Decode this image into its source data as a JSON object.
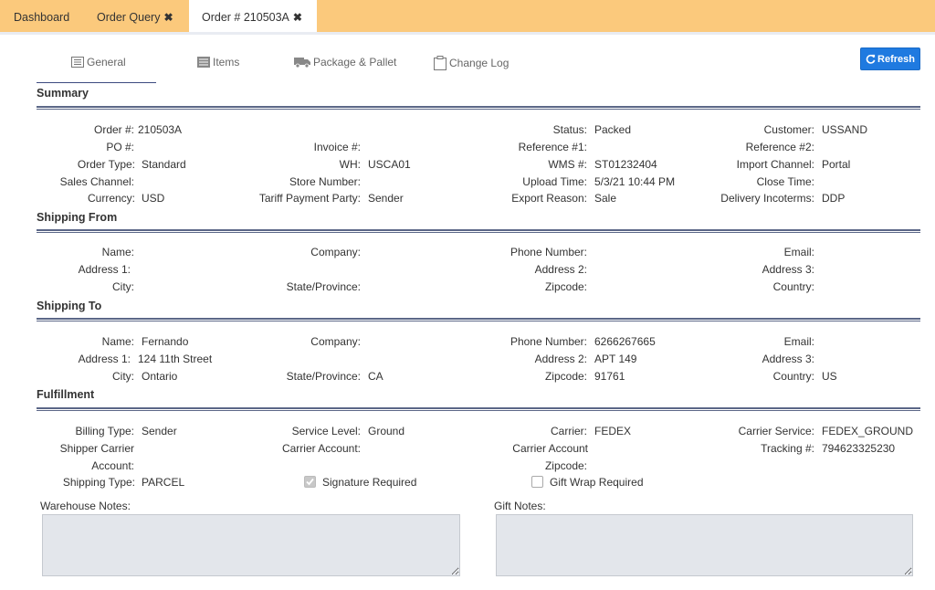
{
  "top_tabs": {
    "dashboard": "Dashboard",
    "order_query": "Order Query",
    "order_detail": "Order # 210503A",
    "close_glyph": "✖"
  },
  "inner_tabs": {
    "general": "General",
    "items": "Items",
    "package": "Package & Pallet",
    "change_log": "Change Log"
  },
  "refresh_label": "Refresh",
  "summary": {
    "title": "Summary",
    "order_no_label": "Order #:",
    "order_no": "210503A",
    "po_label": "PO #:",
    "po": "",
    "order_type_label": "Order Type:",
    "order_type": "Standard",
    "sales_channel_label": "Sales Channel:",
    "sales_channel": "",
    "currency_label": "Currency:",
    "currency": "USD",
    "invoice_label": "Invoice #:",
    "invoice": "",
    "wh_label": "WH:",
    "wh": "USCA01",
    "store_number_label": "Store Number:",
    "store_number": "",
    "tariff_label": "Tariff Payment Party:",
    "tariff": "Sender",
    "status_label": "Status:",
    "status": "Packed",
    "ref1_label": "Reference #1:",
    "ref1": "",
    "wms_label": "WMS #:",
    "wms": "ST01232404",
    "upload_time_label": "Upload Time:",
    "upload_time": "5/3/21 10:44 PM",
    "export_reason_label": "Export Reason:",
    "export_reason": "Sale",
    "customer_label": "Customer:",
    "customer": "USSAND",
    "ref2_label": "Reference #2:",
    "ref2": "",
    "import_channel_label": "Import Channel:",
    "import_channel": "Portal",
    "close_time_label": "Close Time:",
    "close_time": "",
    "delivery_incoterms_label": "Delivery Incoterms:",
    "delivery_incoterms": "DDP"
  },
  "shipping_from": {
    "title": "Shipping From",
    "name_label": "Name:",
    "name": "",
    "address1_label": "Address 1:",
    "address1": "",
    "city_label": "City:",
    "city": "",
    "company_label": "Company:",
    "company": "",
    "state_label": "State/Province:",
    "state": "",
    "phone_label": "Phone Number:",
    "phone": "",
    "address2_label": "Address 2:",
    "address2": "",
    "zipcode_label": "Zipcode:",
    "zipcode": "",
    "email_label": "Email:",
    "email": "",
    "address3_label": "Address 3:",
    "address3": "",
    "country_label": "Country:",
    "country": ""
  },
  "shipping_to": {
    "title": "Shipping To",
    "name_label": "Name:",
    "name": "Fernando",
    "address1_label": "Address 1:",
    "address1": "124 11th Street",
    "city_label": "City:",
    "city": "Ontario",
    "company_label": "Company:",
    "company": "",
    "state_label": "State/Province:",
    "state": "CA",
    "phone_label": "Phone Number:",
    "phone": "6266267665",
    "address2_label": "Address 2:",
    "address2": "APT 149",
    "zipcode_label": "Zipcode:",
    "zipcode": "91761",
    "email_label": "Email:",
    "email": "",
    "address3_label": "Address 3:",
    "address3": "",
    "country_label": "Country:",
    "country": "US"
  },
  "fulfillment": {
    "title": "Fulfillment",
    "billing_type_label": "Billing Type:",
    "billing_type": "Sender",
    "shipper_carrier_label_1": "Shipper Carrier",
    "shipper_carrier_label_2": "Account:",
    "shipper_carrier": "",
    "shipping_type_label": "Shipping Type:",
    "shipping_type": "PARCEL",
    "service_level_label": "Service Level:",
    "service_level": "Ground",
    "carrier_account_label": "Carrier Account:",
    "carrier_account": "",
    "signature_required_label": "Signature Required",
    "signature_required": "checked",
    "carrier_label": "Carrier:",
    "carrier": "FEDEX",
    "carrier_account_zip_label_1": "Carrier Account",
    "carrier_account_zip_label_2": "Zipcode:",
    "carrier_account_zip": "",
    "gift_wrap_label": "Gift Wrap Required",
    "gift_wrap": "unchecked",
    "carrier_service_label": "Carrier Service:",
    "carrier_service": "FEDEX_GROUND",
    "tracking_label": "Tracking #:",
    "tracking": "794623325230",
    "warehouse_notes_label": "Warehouse Notes:",
    "warehouse_notes": "",
    "gift_notes_label": "Gift Notes:",
    "gift_notes": ""
  }
}
